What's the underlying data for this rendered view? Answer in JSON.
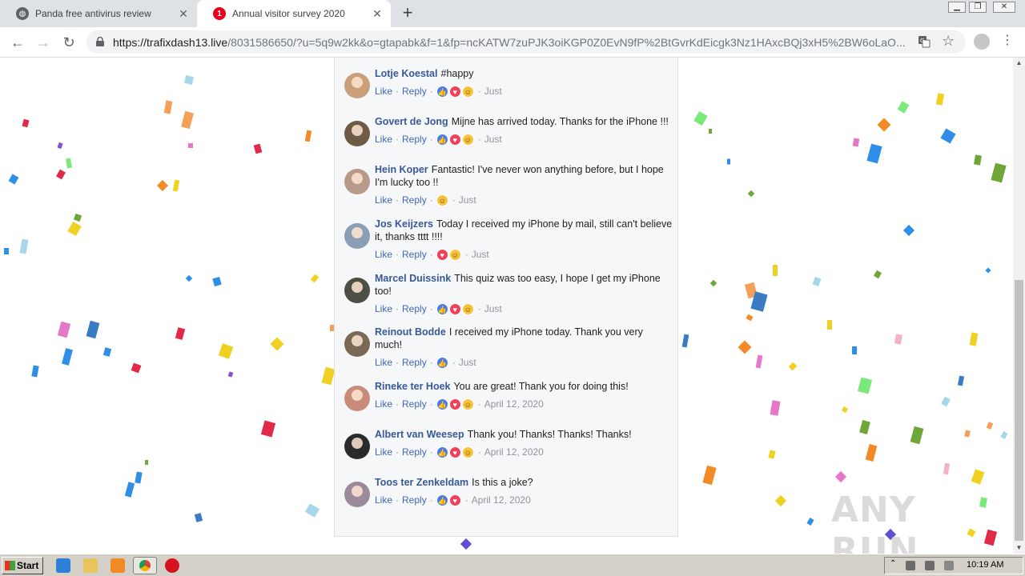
{
  "browser": {
    "tabs": [
      {
        "title": "Panda free antivirus review",
        "active": false,
        "favicon": "globe-icon"
      },
      {
        "title": "Annual visitor survey 2020",
        "active": true,
        "favicon": "alert-badge-icon",
        "badge": "1"
      }
    ],
    "url_host": "https://trafixdash13.live",
    "url_path": "/8031586650/?u=5q9w2kk&o=gtapabk&f=1&fp=ncKATW7zuPJK3oiKGP0Z0EvN9fP%2BtGvrKdEicgk3Nz1HAxcBQj3xH5%2BW6oLaO...",
    "window_buttons": [
      "minimize",
      "restore",
      "close"
    ]
  },
  "comments": [
    {
      "author": "Lotje Koestal",
      "text": "#happy",
      "reactions": [
        "like",
        "love",
        "haha"
      ],
      "time": "Just"
    },
    {
      "author": "Govert de Jong",
      "text": "Mijne has arrived today. Thanks for the iPhone !!!",
      "reactions": [
        "like",
        "love",
        "haha"
      ],
      "time": "Just"
    },
    {
      "author": "Hein Koper",
      "text": "Fantastic! I've never won anything before, but I hope I'm lucky too !!",
      "reactions": [
        "haha"
      ],
      "time": "Just"
    },
    {
      "author": "Jos Keijzers",
      "text": "Today I received my iPhone by mail, still can't believe it, thanks tttt !!!!",
      "reactions": [
        "love",
        "haha"
      ],
      "time": "Just"
    },
    {
      "author": "Marcel Duissink",
      "text": "This quiz was too easy, I hope I get my iPhone too!",
      "reactions": [
        "like",
        "love",
        "haha"
      ],
      "time": "Just"
    },
    {
      "author": "Reinout Bodde",
      "text": "I received my iPhone today. Thank you very much!",
      "reactions": [
        "like"
      ],
      "time": "Just"
    },
    {
      "author": "Rineke ter Hoek",
      "text": "You are great! Thank you for doing this!",
      "reactions": [
        "like",
        "love",
        "haha"
      ],
      "time": "April 12, 2020"
    },
    {
      "author": "Albert van Weesep",
      "text": "Thank you! Thanks! Thanks! Thanks!",
      "reactions": [
        "like",
        "love",
        "haha"
      ],
      "time": "April 12, 2020"
    },
    {
      "author": "Toos ter Zenkeldam",
      "text": "Is this a joke?",
      "reactions": [
        "like",
        "love"
      ],
      "time": "April 12, 2020"
    }
  ],
  "labels": {
    "like": "Like",
    "reply": "Reply",
    "separator": "·"
  },
  "watermark": "ANY RUN",
  "taskbar": {
    "start_label": "Start",
    "clock": "10:19 AM",
    "pinned": [
      "ie-icon",
      "folder-icon",
      "media-player-icon",
      "chrome-icon",
      "alert-icon"
    ]
  },
  "colors": {
    "author": "#385898",
    "link": "#4267b2",
    "like": "#4a7bea",
    "love": "#f0405a",
    "haha": "#f7c33d"
  }
}
